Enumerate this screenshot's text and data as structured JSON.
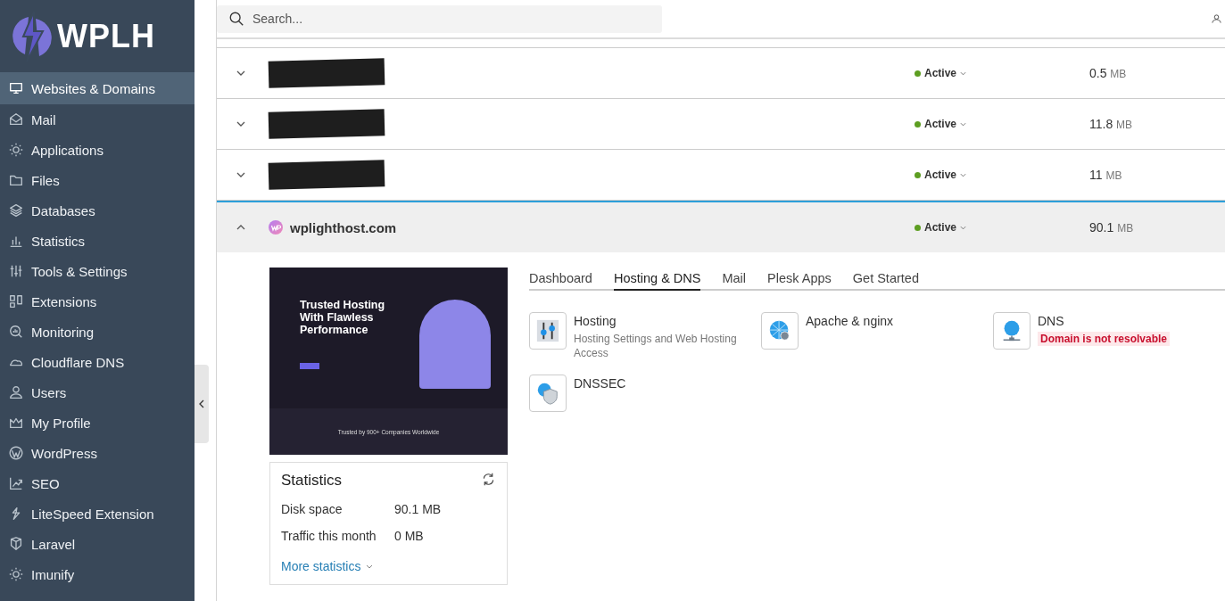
{
  "logo": {
    "text": "WPLH"
  },
  "sidebar": {
    "items": [
      {
        "label": "Websites & Domains",
        "selected": true
      },
      {
        "label": "Mail",
        "selected": false
      },
      {
        "label": "Applications",
        "selected": false
      },
      {
        "label": "Files",
        "selected": false
      },
      {
        "label": "Databases",
        "selected": false
      },
      {
        "label": "Statistics",
        "selected": false
      },
      {
        "label": "Tools & Settings",
        "selected": false
      },
      {
        "label": "Extensions",
        "selected": false
      },
      {
        "label": "Monitoring",
        "selected": false
      },
      {
        "label": "Cloudflare DNS",
        "selected": false
      },
      {
        "label": "Users",
        "selected": false
      },
      {
        "label": "My Profile",
        "selected": false
      },
      {
        "label": "WordPress",
        "selected": false
      },
      {
        "label": "SEO",
        "selected": false
      },
      {
        "label": "LiteSpeed Extension",
        "selected": false
      },
      {
        "label": "Laravel",
        "selected": false
      },
      {
        "label": "Imunify",
        "selected": false
      }
    ]
  },
  "search": {
    "placeholder": "Search..."
  },
  "domains": [
    {
      "redacted": true,
      "expanded": false,
      "status": "Active",
      "size": "0.5",
      "unit": "MB"
    },
    {
      "redacted": true,
      "expanded": false,
      "status": "Active",
      "size": "11.8",
      "unit": "MB"
    },
    {
      "redacted": true,
      "expanded": false,
      "status": "Active",
      "size": "11",
      "unit": "MB"
    },
    {
      "redacted": false,
      "name": "wplighthost.com",
      "expanded": true,
      "status": "Active",
      "size": "90.1",
      "unit": "MB"
    }
  ],
  "preview": {
    "headline": "Trusted Hosting With Flawless Performance",
    "trusted": "Trusted by 900+ Companies Worldwide"
  },
  "statistics": {
    "title": "Statistics",
    "rows": [
      {
        "label": "Disk space",
        "value": "90.1 MB"
      },
      {
        "label": "Traffic this month",
        "value": "0 MB"
      }
    ],
    "more": "More statistics"
  },
  "tabs": [
    {
      "label": "Dashboard",
      "selected": false
    },
    {
      "label": "Hosting & DNS",
      "selected": true
    },
    {
      "label": "Mail",
      "selected": false
    },
    {
      "label": "Plesk Apps",
      "selected": false
    },
    {
      "label": "Get Started",
      "selected": false
    }
  ],
  "tools": [
    {
      "title": "Hosting",
      "description": "Hosting Settings and Web Hosting Access"
    },
    {
      "title": "Apache & nginx"
    },
    {
      "title": "DNS",
      "warning": "Domain is not resolvable"
    },
    {
      "title": "DNSSEC"
    }
  ]
}
